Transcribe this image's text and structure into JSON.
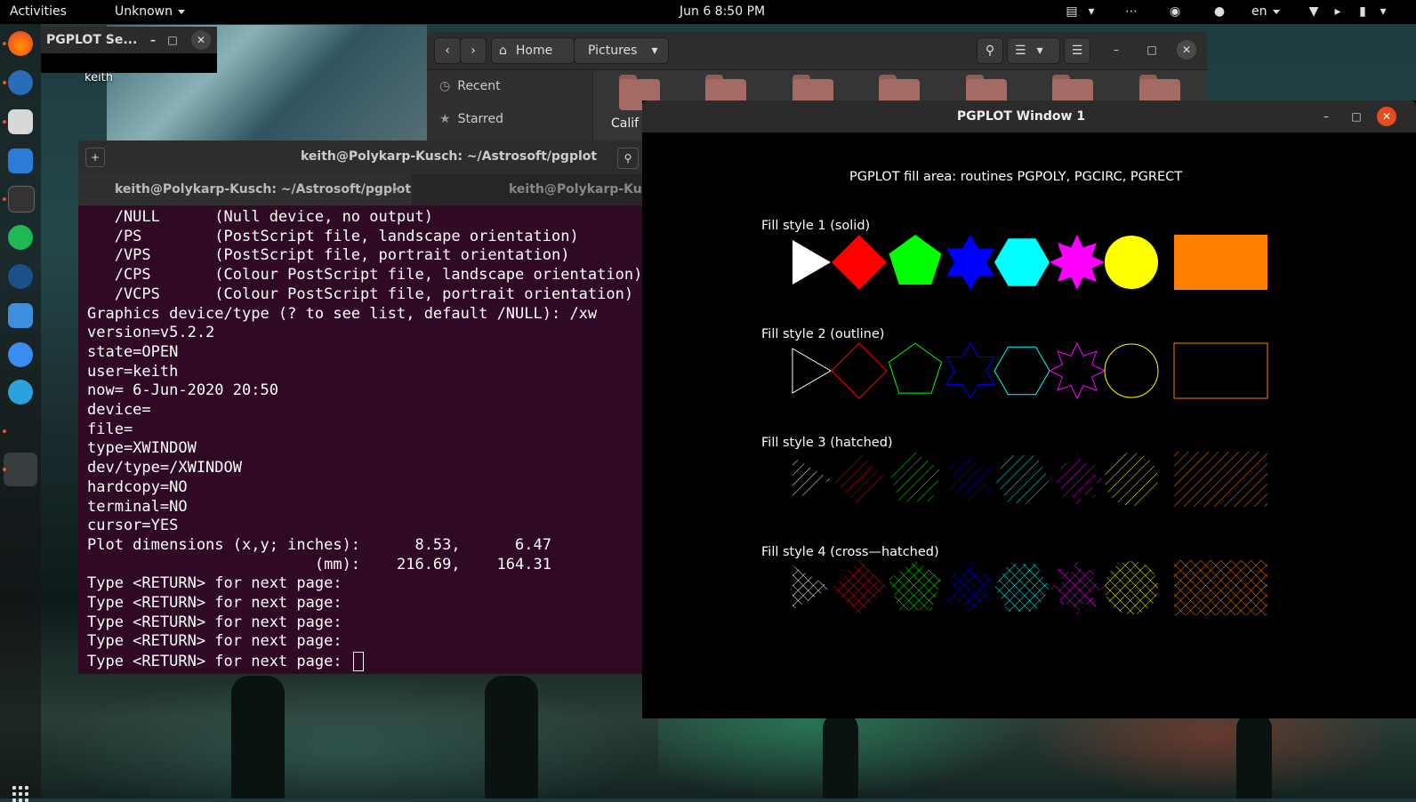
{
  "topbar": {
    "activities": "Activities",
    "app_menu": "Unknown",
    "clock": "Jun 6  8:50 PM",
    "lang": "en"
  },
  "desktop": {
    "icon_label": "keith"
  },
  "server_window": {
    "title": "PGPLOT Se..."
  },
  "files": {
    "path": [
      "Home",
      "Pictures"
    ],
    "sidebar": [
      "Recent",
      "Starred"
    ],
    "folder_label": "Calif",
    "folder_count": 7
  },
  "terminal": {
    "title": "keith@Polykarp-Kusch: ~/Astrosoft/pgplot",
    "tabs": [
      "keith@Polykarp-Kusch: ~/Astrosoft/pgplot",
      "keith@Polykarp-Kusch"
    ],
    "lines": [
      "   /NULL      (Null device, no output)",
      "   /PS        (PostScript file, landscape orientation)",
      "   /VPS       (PostScript file, portrait orientation)",
      "   /CPS       (Colour PostScript file, landscape orientation)",
      "   /VCPS      (Colour PostScript file, portrait orientation)",
      "Graphics device/type (? to see list, default /NULL): /xw",
      "version=v5.2.2",
      "state=OPEN",
      "user=keith",
      "now= 6-Jun-2020 20:50",
      "device=",
      "file=",
      "type=XWINDOW",
      "dev/type=/XWINDOW",
      "hardcopy=NO",
      "terminal=NO",
      "cursor=YES",
      "Plot dimensions (x,y; inches):      8.53,      6.47",
      "                         (mm):    216.69,    164.31",
      "Type <RETURN> for next page:",
      "Type <RETURN> for next page:",
      "Type <RETURN> for next page:",
      "Type <RETURN> for next page:",
      "Type <RETURN> for next page: "
    ]
  },
  "pgplot": {
    "window_title": "PGPLOT Window 1",
    "heading": "PGPLOT fill area: routines PGPOLY, PGCIRC, PGRECT",
    "rows": [
      {
        "label": "Fill style 1 (solid)",
        "style": "solid"
      },
      {
        "label": "Fill style 2 (outline)",
        "style": "outline"
      },
      {
        "label": "Fill style 3 (hatched)",
        "style": "hatched"
      },
      {
        "label": "Fill style 4 (cross—hatched)",
        "style": "cross"
      }
    ],
    "shapes": [
      {
        "kind": "polygon",
        "sides": 3,
        "color": "#ffffff"
      },
      {
        "kind": "polygon",
        "sides": 4,
        "color": "#ff0000"
      },
      {
        "kind": "polygon",
        "sides": 5,
        "color": "#00ff00"
      },
      {
        "kind": "star",
        "points": 6,
        "color": "#0000ff"
      },
      {
        "kind": "polygon",
        "sides": 6,
        "color": "#00ffff"
      },
      {
        "kind": "star",
        "points": 8,
        "color": "#ff00ff"
      },
      {
        "kind": "circle",
        "color": "#ffff00"
      },
      {
        "kind": "rect",
        "color": "#ff8000"
      }
    ]
  }
}
